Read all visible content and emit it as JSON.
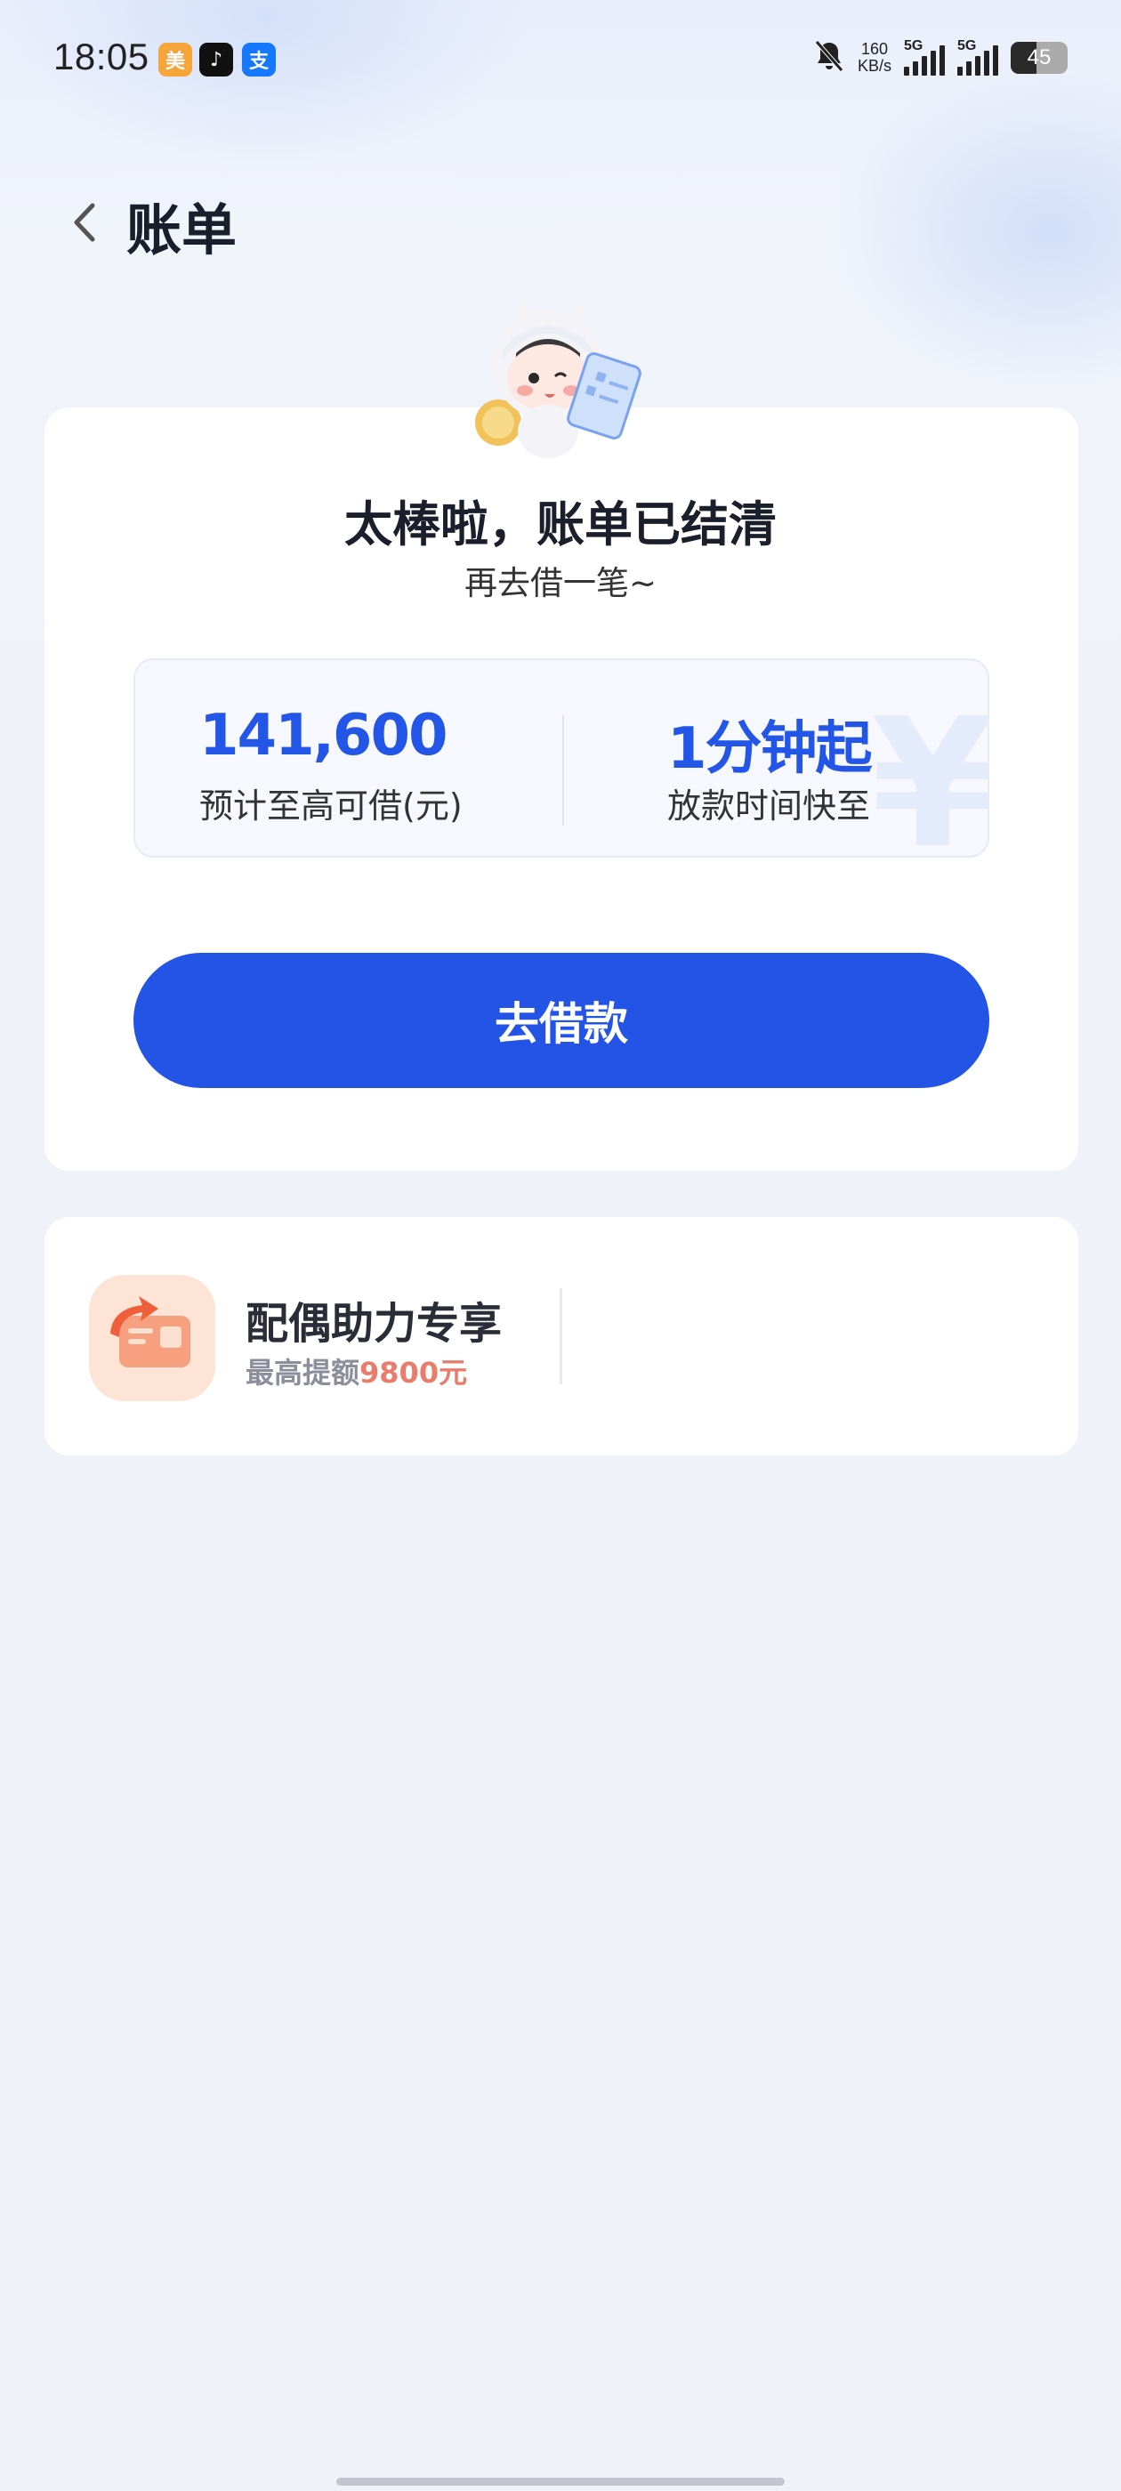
{
  "status_bar": {
    "time": "18:05",
    "net_speed_value": "160",
    "net_speed_unit": "KB/s",
    "sim1_label": "5G",
    "sim2_label": "5G",
    "battery_level": "45",
    "icons": [
      "meituan-app-icon",
      "tiktok-app-icon",
      "alipay-app-icon",
      "bell-muted-icon"
    ]
  },
  "header": {
    "title": "账单"
  },
  "result_card": {
    "headline": "太棒啦，账单已结清",
    "subline": "再去借一笔~",
    "stats": [
      {
        "value": "141,600",
        "label": "预计至高可借(元)"
      },
      {
        "value": "1分钟起",
        "label": "放款时间快至"
      }
    ],
    "cta_label": "去借款"
  },
  "promo_card": {
    "title": "配偶助力专享",
    "subtitle_prefix": "最高提额",
    "subtitle_amount": "9800元"
  },
  "colors": {
    "accent": "#2354e6",
    "promo_amount": "#e87d6b"
  }
}
